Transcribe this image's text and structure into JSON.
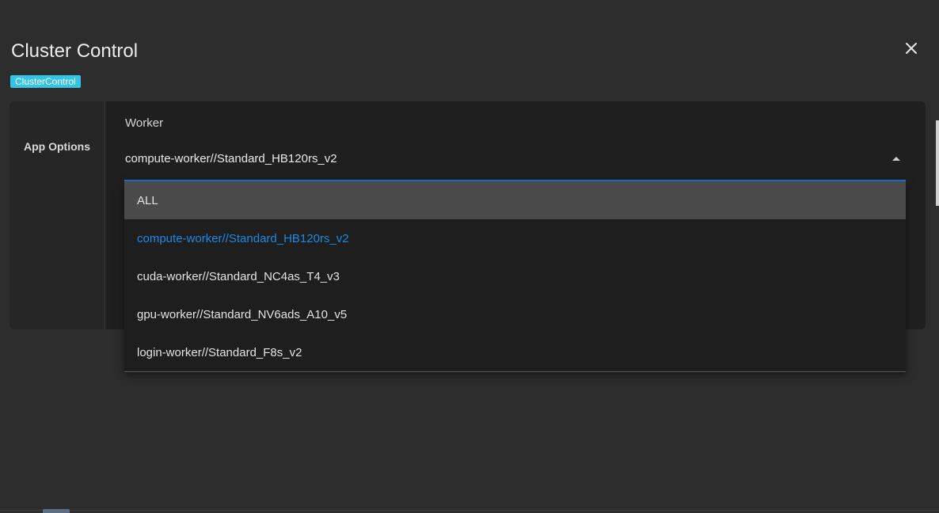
{
  "dialog": {
    "title": "Cluster Control",
    "tag": "ClusterControl",
    "close_icon": "close-icon"
  },
  "card": {
    "label": "App Options",
    "field": {
      "label": "Worker",
      "value": "compute-worker//Standard_HB120rs_v2",
      "dropdown_icon": "caret-up-icon"
    }
  },
  "menu": {
    "options": [
      {
        "label": "ALL"
      },
      {
        "label": "compute-worker//Standard_HB120rs_v2"
      },
      {
        "label": "cuda-worker//Standard_NC4as_T4_v3"
      },
      {
        "label": "gpu-worker//Standard_NV6ads_A10_v5"
      },
      {
        "label": "login-worker//Standard_F8s_v2"
      }
    ],
    "hovered_index": 0,
    "selected_index": 1
  },
  "colors": {
    "accent": "#1976d2",
    "tag": "#33c4e6",
    "background": "#2d2d2d"
  }
}
